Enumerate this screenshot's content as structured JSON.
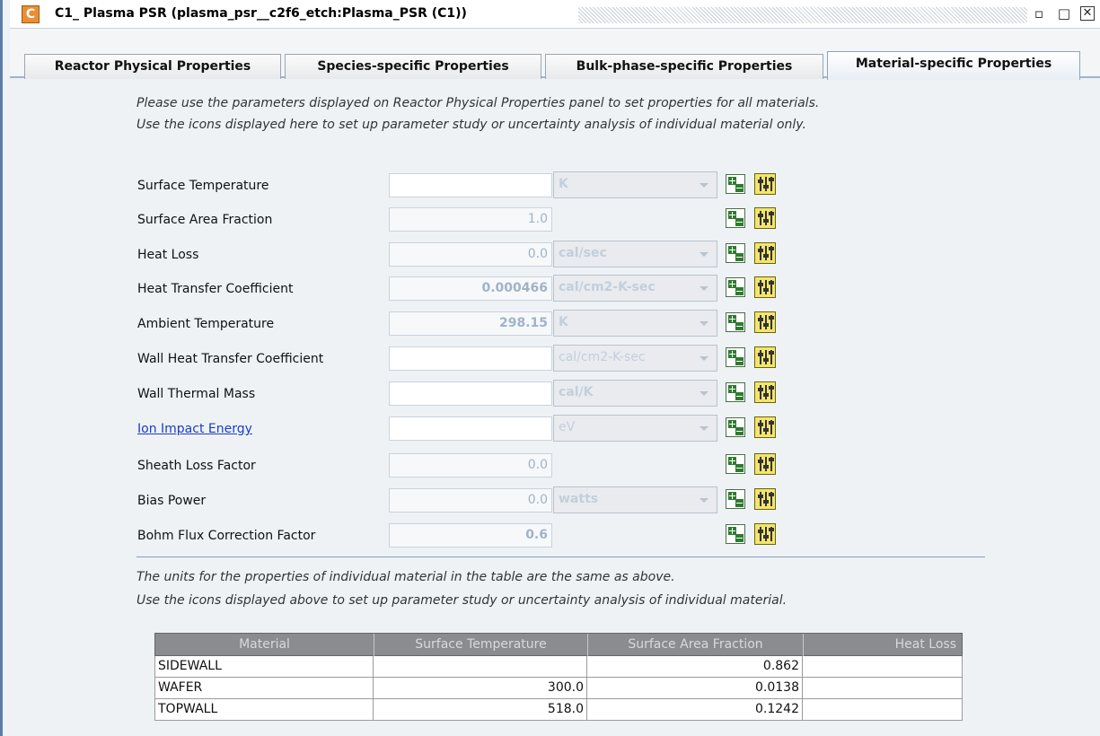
{
  "window": {
    "app_icon_letter": "C",
    "title": "C1_ Plasma PSR  (plasma_psr__c2f6_etch:Plasma_PSR (C1))",
    "controls": [
      "minimize",
      "maximize",
      "close"
    ]
  },
  "tabs": [
    {
      "label": "Reactor Physical Properties",
      "active": false
    },
    {
      "label": "Species-specific Properties",
      "active": false
    },
    {
      "label": "Bulk-phase-specific Properties",
      "active": false
    },
    {
      "label": "Material-specific Properties",
      "active": true
    }
  ],
  "notes": {
    "top_line1": "Please use the parameters displayed on Reactor Physical Properties panel to set properties for all materials.",
    "top_line2": "Use the icons displayed here to set up parameter study or uncertainty analysis of individual material only.",
    "bottom_line1": "The units for the properties of individual material in the table are the same as above.",
    "bottom_line2": "Use the icons displayed above to set up parameter study or uncertainty analysis of individual material."
  },
  "properties": [
    {
      "label": "Surface Temperature",
      "value": "",
      "unit": "K",
      "is_link": false
    },
    {
      "label": "Surface Area Fraction",
      "value": "1.0",
      "unit": null,
      "is_link": false
    },
    {
      "label": "Heat Loss",
      "value": "0.0",
      "unit": "cal/sec",
      "is_link": false
    },
    {
      "label": "Heat Transfer Coefficient",
      "value": "0.000466",
      "unit": "cal/cm2-K-sec",
      "is_link": false
    },
    {
      "label": "Ambient Temperature",
      "value": "298.15",
      "unit": "K",
      "is_link": false
    },
    {
      "label": "Wall Heat Transfer Coefficient",
      "value": "",
      "unit": "cal/cm2-K-sec",
      "is_link": false
    },
    {
      "label": "Wall Thermal Mass",
      "value": "",
      "unit": "cal/K",
      "is_link": false
    },
    {
      "label": "Ion Impact Energy",
      "value": "",
      "unit": "eV",
      "is_link": true
    },
    {
      "label": "Sheath Loss Factor",
      "value": "0.0",
      "unit": null,
      "is_link": false
    },
    {
      "label": "Bias Power",
      "value": "0.0",
      "unit": "watts",
      "is_link": false
    },
    {
      "label": "Bohm Flux Correction Factor",
      "value": "0.6",
      "unit": null,
      "is_link": false
    }
  ],
  "icons": {
    "parameter_study": "plus-minus-icon",
    "uncertainty": "sliders-icon"
  },
  "table": {
    "headers": [
      "Material",
      "Surface Temperature",
      "Surface Area Fraction",
      "Heat Loss"
    ],
    "rows": [
      [
        "SIDEWALL",
        "",
        "0.862",
        ""
      ],
      [
        "WAFER",
        "300.0",
        "0.0138",
        ""
      ],
      [
        "TOPWALL",
        "518.0",
        "0.1242",
        ""
      ]
    ]
  },
  "colors": {
    "accent": "#5b7ea7",
    "table_header_bg": "#8a8c8f",
    "sliders_icon": "#f2e56c",
    "link": "#1a3cc8"
  }
}
